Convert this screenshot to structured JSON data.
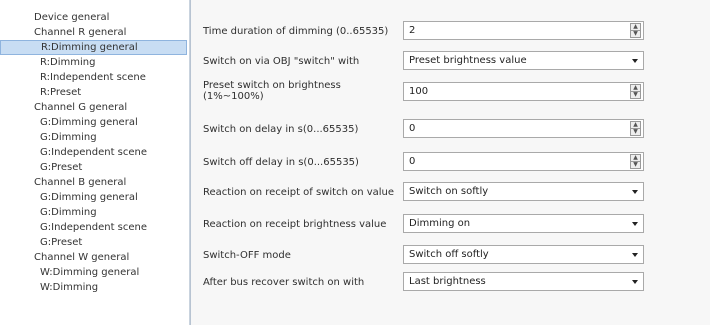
{
  "sidebar": {
    "items": [
      {
        "label": "Device general",
        "level": 0
      },
      {
        "label": "Channel R general",
        "level": 0
      },
      {
        "label": "R:Dimming general",
        "level": 1,
        "selected": true
      },
      {
        "label": "R:Dimming",
        "level": 1
      },
      {
        "label": "R:Independent scene",
        "level": 1
      },
      {
        "label": "R:Preset",
        "level": 1
      },
      {
        "label": "Channel G general",
        "level": 0
      },
      {
        "label": "G:Dimming general",
        "level": 1
      },
      {
        "label": "G:Dimming",
        "level": 1
      },
      {
        "label": "G:Independent scene",
        "level": 1
      },
      {
        "label": "G:Preset",
        "level": 1
      },
      {
        "label": "Channel B general",
        "level": 0
      },
      {
        "label": "G:Dimming general",
        "level": 1
      },
      {
        "label": "G:Dimming",
        "level": 1
      },
      {
        "label": "G:Independent scene",
        "level": 1
      },
      {
        "label": "G:Preset",
        "level": 1
      },
      {
        "label": "Channel W general",
        "level": 0
      },
      {
        "label": "W:Dimming general",
        "level": 1
      },
      {
        "label": "W:Dimming",
        "level": 1
      }
    ]
  },
  "params": [
    {
      "label": "Time duration of dimming (0..65535)",
      "type": "spin",
      "value": "2"
    },
    {
      "label": "Switch on via OBJ \"switch\" with",
      "type": "select",
      "value": "Preset brightness value"
    },
    {
      "label": "Preset switch on brightness\n(1%~100%)",
      "type": "spin",
      "value": "100"
    },
    {
      "label": "Switch on delay in s(0...65535)",
      "type": "spin",
      "value": "0"
    },
    {
      "label": "Switch off delay in s(0...65535)",
      "type": "spin",
      "value": "0"
    },
    {
      "label": "Reaction on receipt of switch on value",
      "type": "select",
      "value": "Switch on softly"
    },
    {
      "label": "Reaction on receipt brightness value",
      "type": "select",
      "value": "Dimming on"
    },
    {
      "label": "Switch-OFF mode",
      "type": "select",
      "value": "Switch off softly"
    },
    {
      "label": "After bus recover switch on with",
      "type": "select",
      "value": "Last brightness"
    }
  ],
  "colors": {
    "selection_bg": "#c8ddf3",
    "panel_bg": "#f7f7f7",
    "border": "#a9a9a9"
  }
}
